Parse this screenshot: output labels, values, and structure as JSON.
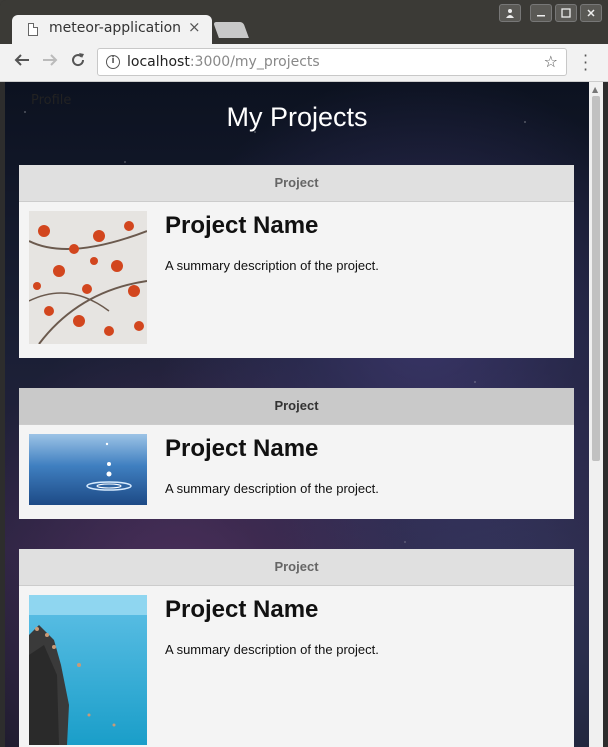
{
  "browser": {
    "tab_title": "meteor-application",
    "tab_close": "×",
    "url_host": "localhost",
    "url_path": ":3000/my_projects",
    "info_icon": "i"
  },
  "page": {
    "profile_label": "Profile",
    "title": "My Projects"
  },
  "projects": [
    {
      "header": "Project",
      "name": "Project Name",
      "description": "A summary description of the project.",
      "image": "cherry-blossom"
    },
    {
      "header": "Project",
      "name": "Project Name",
      "description": "A summary description of the project.",
      "image": "water-drop"
    },
    {
      "header": "Project",
      "name": "Project Name",
      "description": "A summary description of the project.",
      "image": "cliff-sea"
    }
  ]
}
